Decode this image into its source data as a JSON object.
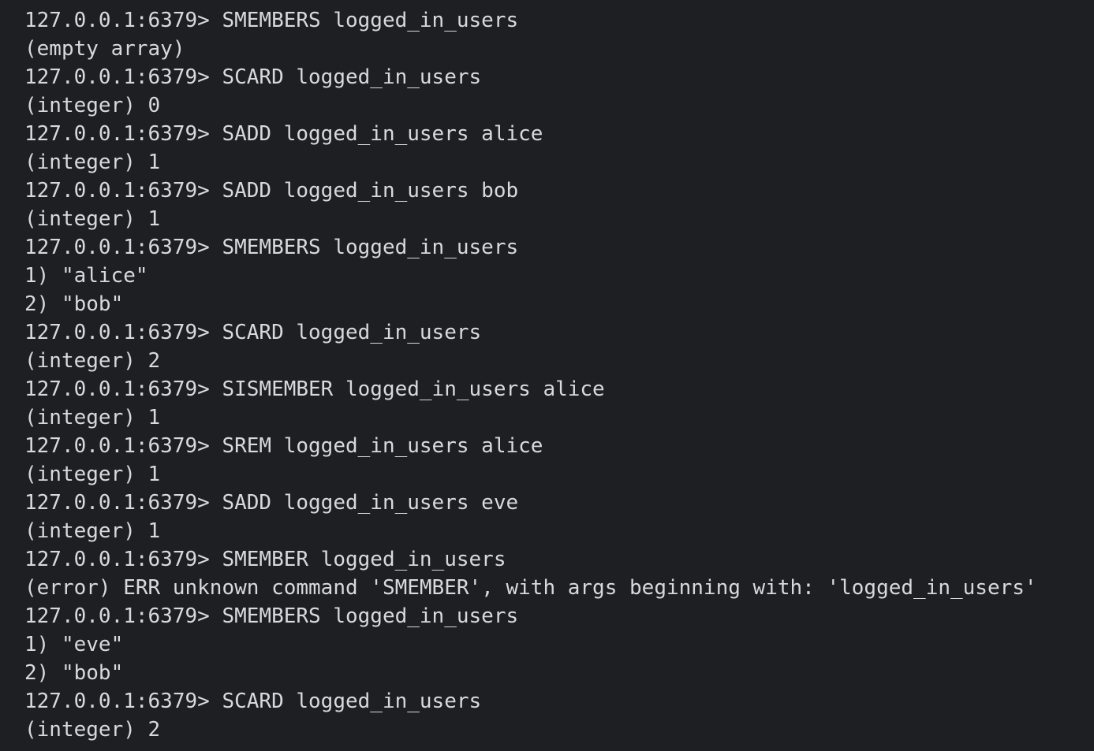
{
  "terminal": {
    "lines": [
      "127.0.0.1:6379> SMEMBERS logged_in_users",
      "(empty array)",
      "127.0.0.1:6379> SCARD logged_in_users",
      "(integer) 0",
      "127.0.0.1:6379> SADD logged_in_users alice",
      "(integer) 1",
      "127.0.0.1:6379> SADD logged_in_users bob",
      "(integer) 1",
      "127.0.0.1:6379> SMEMBERS logged_in_users",
      "1) \"alice\"",
      "2) \"bob\"",
      "127.0.0.1:6379> SCARD logged_in_users",
      "(integer) 2",
      "127.0.0.1:6379> SISMEMBER logged_in_users alice",
      "(integer) 1",
      "127.0.0.1:6379> SREM logged_in_users alice",
      "(integer) 1",
      "127.0.0.1:6379> SADD logged_in_users eve",
      "(integer) 1",
      "127.0.0.1:6379> SMEMBER logged_in_users",
      "(error) ERR unknown command 'SMEMBER', with args beginning with: 'logged_in_users'",
      "127.0.0.1:6379> SMEMBERS logged_in_users",
      "1) \"eve\"",
      "2) \"bob\"",
      "127.0.0.1:6379> SCARD logged_in_users",
      "(integer) 2"
    ]
  }
}
